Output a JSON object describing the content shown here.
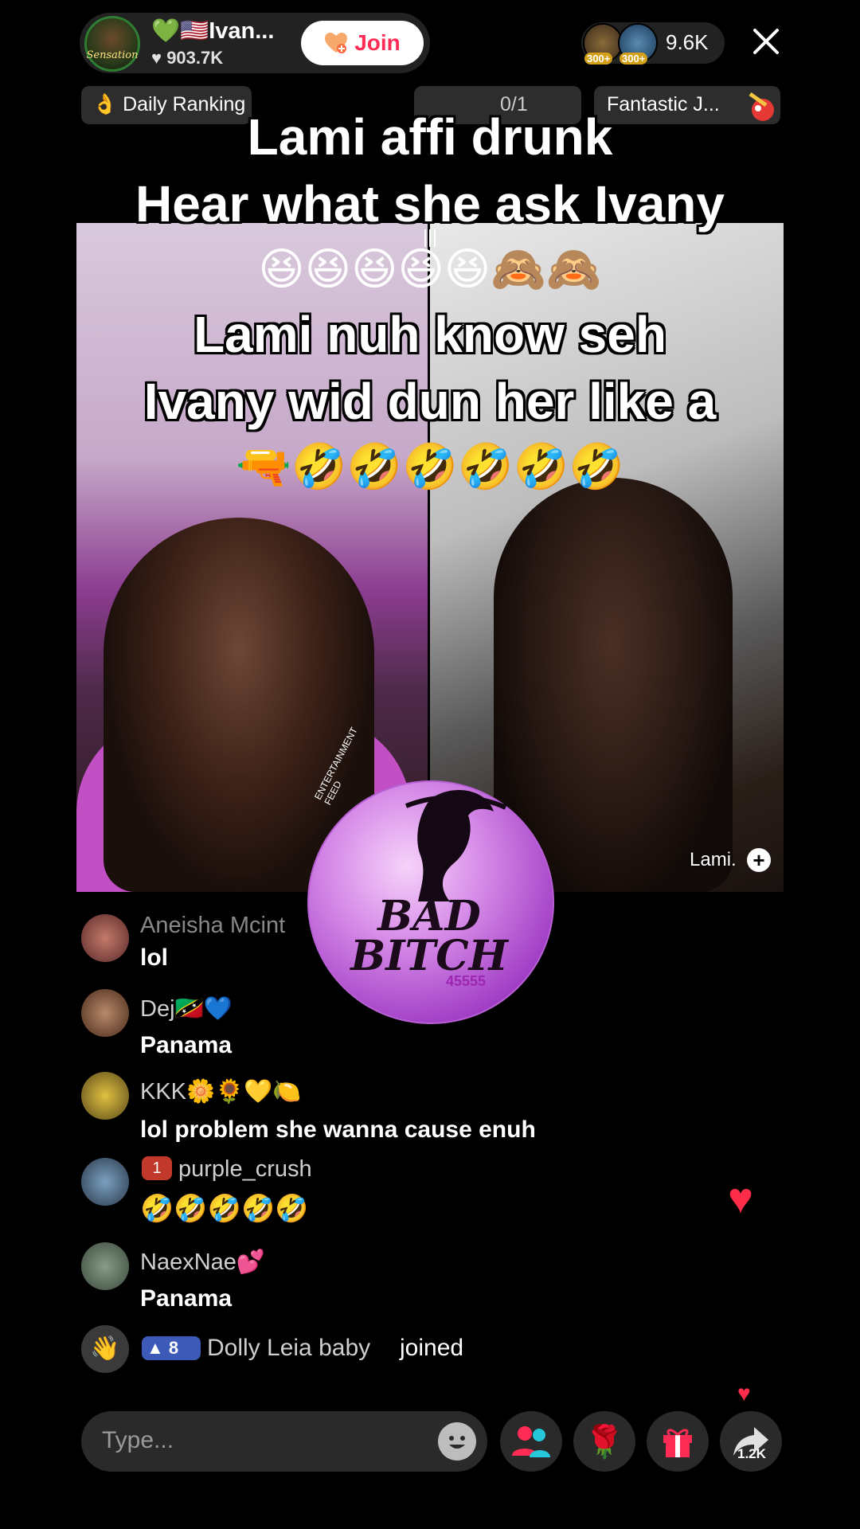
{
  "host": {
    "name": "💚🇺🇸Ivan...",
    "likes": "903.7K",
    "avatar_tag": "Sensation",
    "join_label": "Join"
  },
  "viewers": {
    "badge_1": "300+",
    "badge_2": "300+",
    "count": "9.6K"
  },
  "rank_row": {
    "daily": "👌 Daily Ranking",
    "pk": "0/1",
    "fantastic": "Fantastic J..."
  },
  "caption": {
    "line1": "Lami affi drunk",
    "line2": "Hear what she ask Ivany",
    "emoji1": "😆😆😆😆😆🙈🙈",
    "line3": "Lami nuh know seh",
    "line4": "Ivany wid dun her like a",
    "emoji2": "🔫🤣🤣🤣🤣🤣🤣"
  },
  "guest": {
    "label": "Lami.",
    "add": "+"
  },
  "logo": {
    "arc_text": "ENTERTAINMENT FEED",
    "line1": "BAD",
    "line2": "BITCH",
    "number": "45555"
  },
  "comments": [
    {
      "name": "Aneisha Mcint",
      "message": "lol"
    },
    {
      "name": "Dej🇰🇳💙",
      "message": "Panama"
    },
    {
      "name": "KKK🌼🌻💛🍋",
      "message": "lol problem she wanna cause enuh"
    },
    {
      "badge": "1",
      "name": "purple_crush",
      "message": "🤣🤣🤣🤣🤣"
    },
    {
      "name": "NaexNae💕",
      "message": "Panama"
    }
  ],
  "join_event": {
    "badge": "8",
    "user": "Dolly Leia baby",
    "action": "joined"
  },
  "bottom_bar": {
    "placeholder": "Type...",
    "share_count": "1.2K"
  },
  "icons": {
    "host_avatar": "host-avatar-icon",
    "join": "heart-plus-icon",
    "close": "close-icon",
    "people": "people-icon",
    "rose": "rose-icon",
    "gift": "gift-icon",
    "share": "share-arrow-icon",
    "emoji": "emoji-face-icon",
    "wave": "wave-hand-icon",
    "heart": "heart-icon"
  },
  "colors": {
    "accent": "#fe2c55",
    "join_text": "#fe2c55",
    "logo_purple": "#a23fc6",
    "level_badge": "#3d5ab8"
  }
}
